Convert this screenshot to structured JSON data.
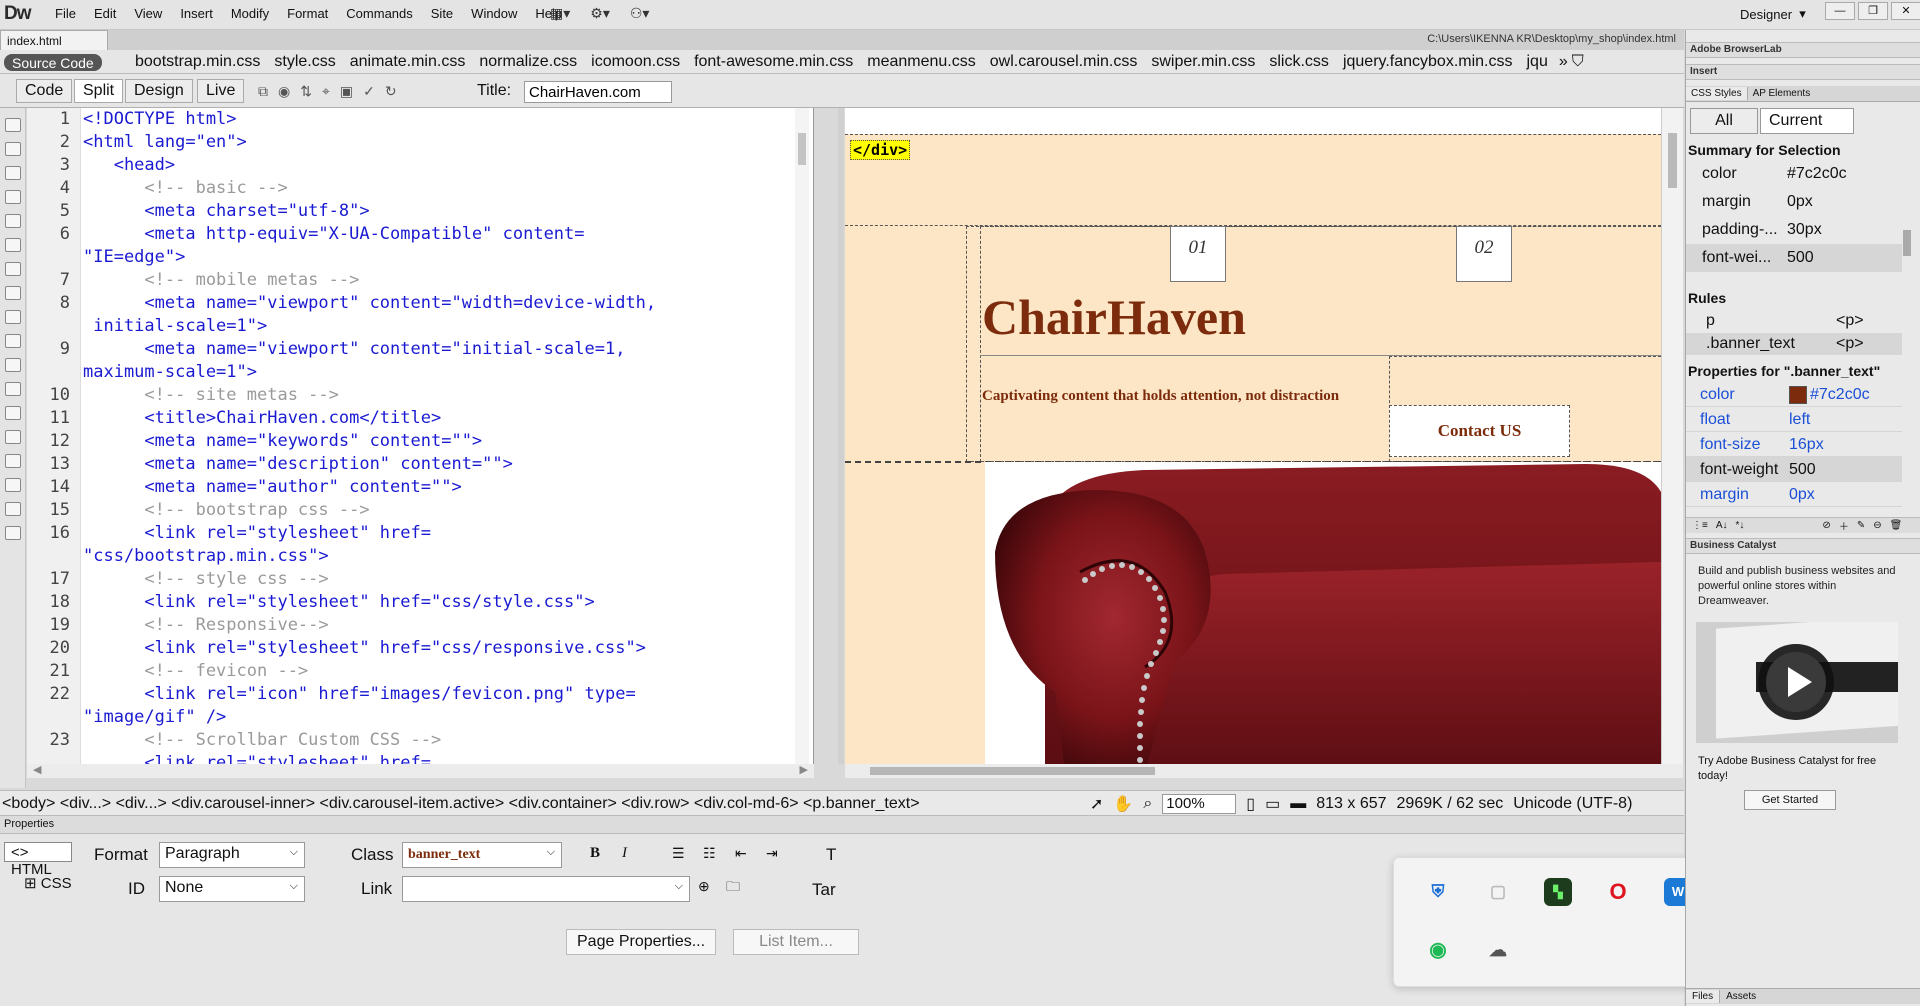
{
  "app": {
    "logo": "Dw"
  },
  "menu": [
    "File",
    "Edit",
    "View",
    "Insert",
    "Modify",
    "Format",
    "Commands",
    "Site",
    "Window",
    "Help"
  ],
  "workspace": {
    "label": "Designer",
    "caret": "▾"
  },
  "window_controls": [
    "—",
    "❐",
    "✕"
  ],
  "document": {
    "tab": "index.html",
    "path": "C:\\Users\\IKENNA KR\\Desktop\\my_shop\\index.html"
  },
  "related_files": {
    "source_code": "Source Code",
    "files": [
      "bootstrap.min.css",
      "style.css",
      "animate.min.css",
      "normalize.css",
      "icomoon.css",
      "font-awesome.min.css",
      "meanmenu.css",
      "owl.carousel.min.css",
      "swiper.min.css",
      "slick.css",
      "jquery.fancybox.min.css",
      "jqu"
    ]
  },
  "view_buttons": {
    "code": "Code",
    "split": "Split",
    "design": "Design",
    "live": "Live"
  },
  "title_field": {
    "label": "Title:",
    "value": "ChairHaven.com"
  },
  "code": {
    "line_numbers": [
      "1",
      "2",
      "3",
      "4",
      "5",
      "6",
      "",
      "7",
      "8",
      "",
      "9",
      "",
      "10",
      "11",
      "12",
      "13",
      "14",
      "15",
      "16",
      "",
      "17",
      "18",
      "19",
      "20",
      "21",
      "22",
      "",
      "23",
      ""
    ],
    "lines": [
      "<!DOCTYPE html>",
      "<html lang=\"en\">",
      "   <head>",
      "      <!-- basic -->",
      "      <meta charset=\"utf-8\">",
      "      <meta http-equiv=\"X-UA-Compatible\" content=",
      "\"IE=edge\">",
      "      <!-- mobile metas -->",
      "      <meta name=\"viewport\" content=\"width=device-width,",
      " initial-scale=1\">",
      "      <meta name=\"viewport\" content=\"initial-scale=1,",
      "maximum-scale=1\">",
      "      <!-- site metas -->",
      "      <title>ChairHaven.com</title>",
      "      <meta name=\"keywords\" content=\"\">",
      "      <meta name=\"description\" content=\"\">",
      "      <meta name=\"author\" content=\"\">",
      "      <!-- bootstrap css -->",
      "      <link rel=\"stylesheet\" href=",
      "\"css/bootstrap.min.css\">",
      "      <!-- style css -->",
      "      <link rel=\"stylesheet\" href=\"css/style.css\">",
      "      <!-- Responsive-->",
      "      <link rel=\"stylesheet\" href=\"css/responsive.css\">",
      "      <!-- fevicon -->",
      "      <link rel=\"icon\" href=\"images/fevicon.png\" type=",
      "\"image/gif\" />",
      "      <!-- Scrollbar Custom CSS -->",
      "      <link rel=\"stylesheet\" href="
    ]
  },
  "design": {
    "div_tag": "</div>",
    "box1": "01",
    "box2": "02",
    "brand": "ChairHaven",
    "banner_text": "Captivating content that holds attention, not distraction",
    "contact": "Contact US"
  },
  "status": {
    "tag_selector": "<body> <div...> <div...> <div.carousel-inner> <div.carousel-item.active> <div.container> <div.row> <div.col-md-6> <p.banner_text>",
    "zoom": "100%",
    "dimensions": "813 x 657",
    "size_time": "2969K / 62 sec",
    "encoding": "Unicode (UTF-8)"
  },
  "properties": {
    "panel_title": "Properties",
    "html_tab": "HTML",
    "css_tab": "CSS",
    "format_label": "Format",
    "format_value": "Paragraph",
    "id_label": "ID",
    "id_value": "None",
    "class_label": "Class",
    "class_value": "banner_text",
    "link_label": "Link",
    "link_value": "",
    "target_label": "Tar",
    "title_letter": "T",
    "bold": "B",
    "italic": "I",
    "page_properties": "Page Properties...",
    "list_item": "List Item..."
  },
  "right_panel": {
    "browserlab": "Adobe BrowserLab",
    "insert": "Insert",
    "tabs": [
      "CSS Styles",
      "AP Elements"
    ],
    "all_btn": "All",
    "current_btn": "Current",
    "summary_title": "Summary for Selection",
    "summary": [
      {
        "name": "color",
        "value": "#7c2c0c"
      },
      {
        "name": "margin",
        "value": "0px"
      },
      {
        "name": "padding-...",
        "value": "30px"
      },
      {
        "name": "font-wei...",
        "value": "500"
      }
    ],
    "rules_title": "Rules",
    "rules": [
      {
        "name": "p",
        "value": "<p>"
      },
      {
        "name": ".banner_text",
        "value": "<p>"
      }
    ],
    "props_title": "Properties for \".banner_text\"",
    "props": [
      {
        "name": "color",
        "value": "#7c2c0c"
      },
      {
        "name": "float",
        "value": "left"
      },
      {
        "name": "font-size",
        "value": "16px"
      },
      {
        "name": "font-weight",
        "value": "500"
      },
      {
        "name": "margin",
        "value": "0px"
      }
    ],
    "business_catalyst": "Business Catalyst",
    "bc_text": "Build and publish business websites and powerful online stores within Dreamweaver.",
    "bc_try": "Try Adobe Business Catalyst for free today!",
    "get_started": "Get Started",
    "bottom_tabs": [
      "Files",
      "Assets"
    ]
  },
  "colors": {
    "brand": "#7c2c0c",
    "design_bg": "#fce6c6",
    "tag_highlight": "#ffff00"
  }
}
